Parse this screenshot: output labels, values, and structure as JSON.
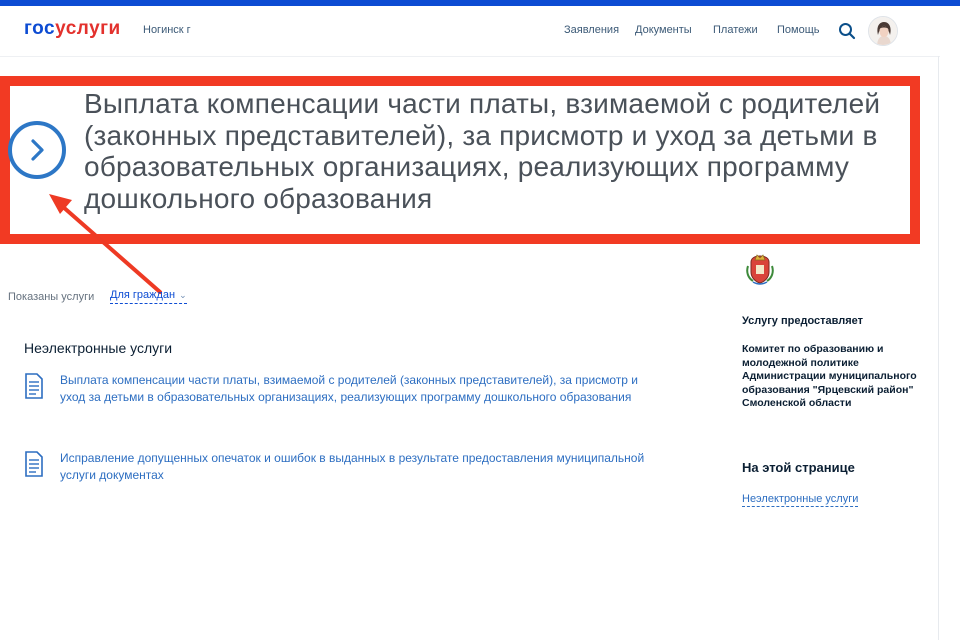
{
  "header": {
    "logo_part1": "гос",
    "logo_part2": "услуги",
    "location": "Ногинск г",
    "nav": {
      "applications": "Заявления",
      "documents": "Документы",
      "payments": "Платежи",
      "help": "Помощь"
    }
  },
  "main": {
    "title": "Выплата компенсации части платы, взимаемой с родителей (законных представителей), за присмотр и уход за детьми в образовательных организациях, реализующих программу дошкольного образования",
    "filter": {
      "label": "Показаны услуги",
      "value": "Для граждан"
    },
    "section_title": "Неэлектронные услуги",
    "services": [
      {
        "label": "Выплата компенсации части платы, взимаемой с родителей (законных представителей), за присмотр и уход за детьми в образовательных организациях, реализующих программу дошкольного образования"
      },
      {
        "label": "Исправление допущенных опечаток и ошибок в выданных в результате предоставления муниципальной услуги документах"
      }
    ]
  },
  "sidebar": {
    "provider_heading": "Услугу предоставляет",
    "provider_name": "Комитет по образованию и молодежной политике Администрации муниципального образования \"Ярцевский район\" Смоленской области",
    "on_page_heading": "На этой странице",
    "anchor_link": "Неэлектронные услуги"
  },
  "annotation": {
    "box_color": "#f23a23",
    "arrow_color": "#ee3a24"
  },
  "colors": {
    "brand_blue": "#0d4cd3",
    "brand_red": "#e3312d",
    "link": "#2d6ec1"
  }
}
